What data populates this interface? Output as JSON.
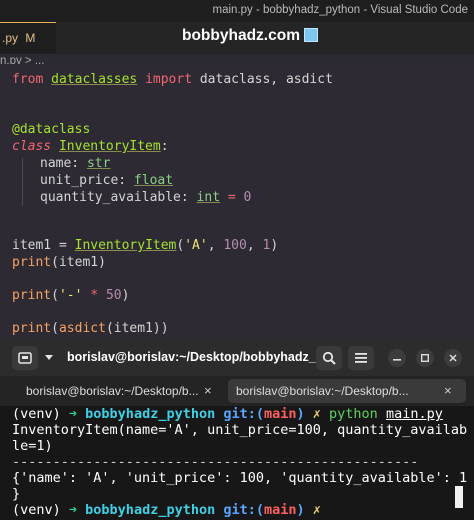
{
  "window": {
    "title": "main.py - bobbyhadz_python - Visual Studio Code"
  },
  "tab": {
    "label": ".py",
    "status": "M",
    "close": "×"
  },
  "watermark": {
    "text": "bobbyhadz.com"
  },
  "breadcrumb": {
    "text": "n.py > ..."
  },
  "code": {
    "l1_from": "from",
    "l1_mod": "dataclasses",
    "l1_import": "import",
    "l1_rest": "dataclass, asdict",
    "l2_dec": "@dataclass",
    "l3_class": "class",
    "l3_name": "InventoryItem",
    "l3_colon": ":",
    "l4_field": "name: ",
    "l4_type": "str",
    "l5_field": "unit_price: ",
    "l5_type": "float",
    "l6_field": "quantity_available: ",
    "l6_type": "int",
    "l6_eq": " = ",
    "l6_val": "0",
    "l7_var": "item1 = ",
    "l7_cls": "InventoryItem",
    "l7_open": "(",
    "l7_s": "'A'",
    "l7_mid": ", ",
    "l7_n1": "100",
    "l7_sep": ", ",
    "l7_n2": "1",
    "l7_close": ")",
    "l8_fn": "print",
    "l8_rest": "(item1)",
    "l9_fn": "print",
    "l9_open": "(",
    "l9_s": "'-'",
    "l9_op": " * ",
    "l9_n": "50",
    "l9_close": ")",
    "l10_fn": "print",
    "l10_open": "(",
    "l10_fn2": "asdict",
    "l10_rest": "(item1))"
  },
  "terminal": {
    "title": "borislav@borislav:~/Desktop/bobbyhadz_...",
    "tab1": "borislav@borislav:~/Desktop/b...",
    "tab2": "borislav@borislav:~/Desktop/b...",
    "tab_close": "×",
    "prompt_venv": "(venv) ",
    "prompt_arrow": "➜ ",
    "prompt_dir": "bobbyhadz_python",
    "prompt_git": " git:(",
    "prompt_branch": "main",
    "prompt_git_close": ")",
    "prompt_x": " ✗ ",
    "cmd": "python",
    "cmd_arg": "main.py",
    "out1": "InventoryItem(name='A', unit_price=100, quantity_availab",
    "out1_end": "le",
    "out2": "le=1)",
    "out3": "--------------------------------------------------",
    "out4": "{'name': 'A', 'unit_price': 100, 'quantity_available': 1",
    "out5": "}"
  },
  "icons": {
    "new_tab": "new-terminal-icon",
    "dropdown": "chevron-down-icon",
    "search": "search-icon",
    "menu": "hamburger-menu-icon",
    "minimize": "minimize-icon",
    "maximize": "maximize-icon",
    "close": "close-icon"
  },
  "colors": {
    "accent_green": "#29d398",
    "accent_cyan": "#3fd0e6",
    "git_blue": "#5aa4ff",
    "git_red": "#ff5f5f"
  }
}
